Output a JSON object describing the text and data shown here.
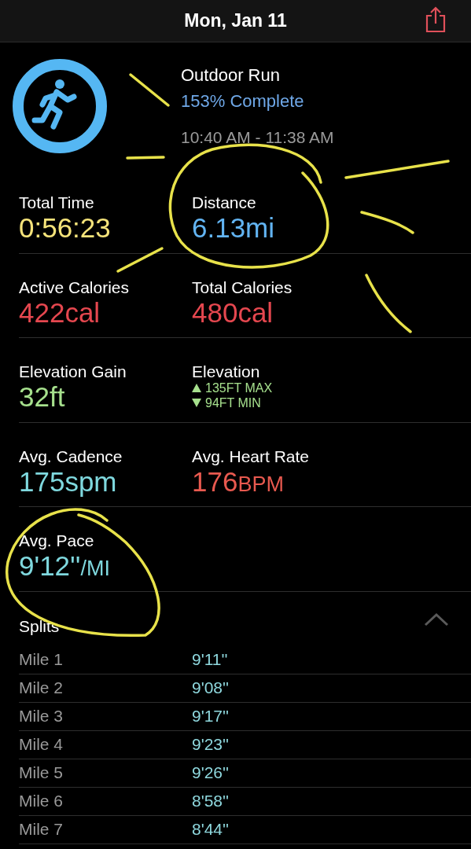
{
  "header": {
    "title": "Mon, Jan 11"
  },
  "workout": {
    "name": "Outdoor Run",
    "progress": "153% Complete",
    "time_range": "10:40 AM - 11:38 AM"
  },
  "metrics": [
    {
      "kind": "value",
      "label": "Total Time",
      "value": "0:56:23",
      "color": "#f5e37a"
    },
    {
      "kind": "value",
      "label": "Distance",
      "value": "6.13mi",
      "color": "#62b4f2"
    },
    {
      "kind": "value",
      "label": "Active Calories",
      "value": "422cal",
      "color": "#e5474f"
    },
    {
      "kind": "value",
      "label": "Total Calories",
      "value": "480cal",
      "color": "#e5474f"
    },
    {
      "kind": "value",
      "label": "Elevation Gain",
      "value": "32ft",
      "color": "#a6e08d"
    },
    {
      "kind": "range",
      "label": "Elevation",
      "max": "135FT MAX",
      "min": "94FT MIN",
      "color": "#a6e08d"
    },
    {
      "kind": "value",
      "label": "Avg. Cadence",
      "value": "175spm",
      "color": "#7fd8de"
    },
    {
      "kind": "value",
      "label": "Avg. Heart Rate",
      "value": "176",
      "unit": "BPM",
      "color": "#e8594f"
    },
    {
      "kind": "value",
      "label": "Avg. Pace",
      "value": "9'12''",
      "unit": "/MI",
      "color": "#7fd8de"
    }
  ],
  "splits": {
    "title": "Splits",
    "expanded": true,
    "rows": [
      {
        "label": "Mile 1",
        "pace": "9'11''"
      },
      {
        "label": "Mile 2",
        "pace": "9'08''"
      },
      {
        "label": "Mile 3",
        "pace": "9'17''"
      },
      {
        "label": "Mile 4",
        "pace": "9'23''"
      },
      {
        "label": "Mile 5",
        "pace": "9'26''"
      },
      {
        "label": "Mile 6",
        "pace": "8'58''"
      },
      {
        "label": "Mile 7",
        "pace": "8'44''"
      }
    ]
  }
}
